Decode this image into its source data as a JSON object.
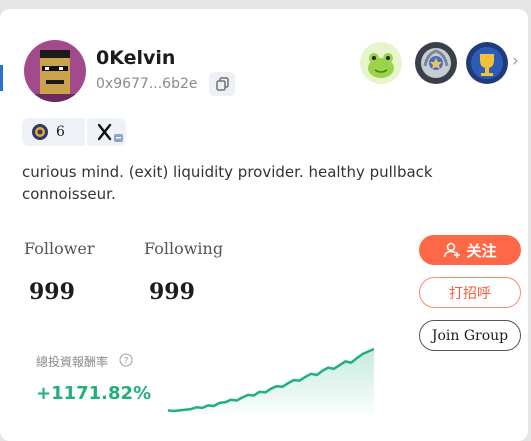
{
  "profile": {
    "name": "0Kelvin",
    "address": "0x9677...6b2e",
    "bio": "curious mind. (exit) liquidity provider. healthy pullback connoisseur."
  },
  "social": {
    "badge_count": "6"
  },
  "stats": {
    "follower_label": "Follower",
    "follower_count": "999",
    "following_label": "Following",
    "following_count": "999"
  },
  "actions": {
    "follow_label": "关注",
    "greet_label": "打招呼",
    "join_group_label": "Join Group"
  },
  "performance": {
    "roi_label": "總投資報酬率",
    "roi_value": "+1171.82%"
  },
  "colors": {
    "accent_orange": "#ff6846",
    "positive_green": "#21b07a"
  },
  "icons": [
    "avatar-punk",
    "copy-icon",
    "frog-badge-icon",
    "laurel-badge-icon",
    "trophy-badge-icon",
    "chevron-right-icon",
    "token-icon",
    "x-logo-icon",
    "add-user-icon",
    "help-icon"
  ],
  "chart_data": {
    "type": "area",
    "y": [
      1,
      0,
      1,
      2,
      3,
      6,
      5,
      9,
      8,
      13,
      14,
      18,
      17,
      22,
      26,
      25,
      31,
      30,
      36,
      40,
      39,
      45,
      50,
      49,
      55,
      60,
      58,
      65,
      70,
      68,
      74,
      80,
      78,
      85,
      92,
      96,
      100
    ]
  }
}
